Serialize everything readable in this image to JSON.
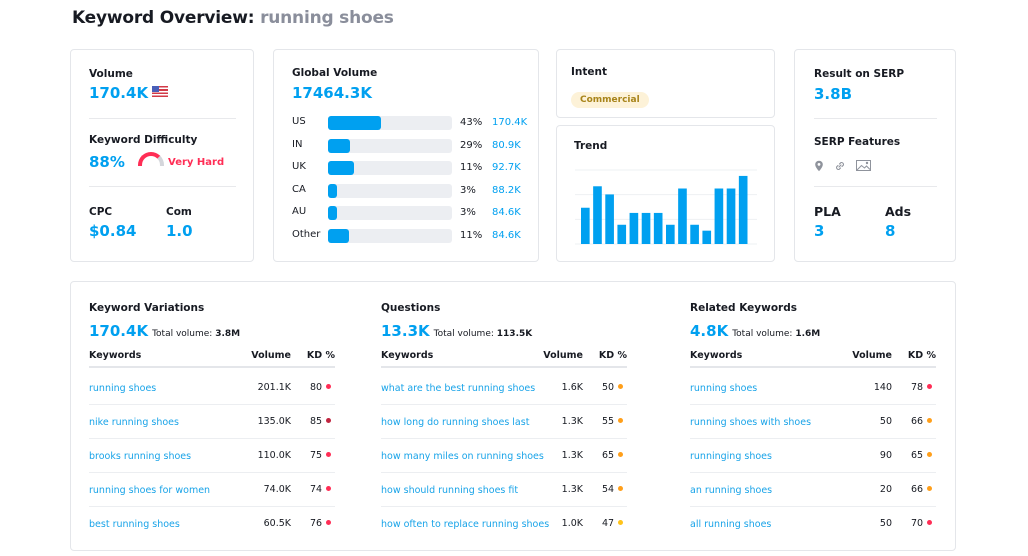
{
  "header": {
    "title_prefix": "Keyword Overview:",
    "keyword": "running shoes"
  },
  "colors": {
    "accent": "#00a0f0",
    "link": "#18a3e8",
    "hard": "#ff2d55",
    "very_hard_dot": "#c0243f",
    "medium": "#ff9f1a",
    "easy": "#ffc31a",
    "intent_bg": "#fdf2d8",
    "intent_text": "#a8841a"
  },
  "volume_card": {
    "volume_label": "Volume",
    "volume_value": "170.4K",
    "flag_icon": "us-flag-icon",
    "kd_label": "Keyword Difficulty",
    "kd_value": "88%",
    "kd_percent": 88,
    "kd_text": "Very Hard",
    "cpc_label": "CPC",
    "cpc_value": "$0.84",
    "com_label": "Com",
    "com_value": "1.0"
  },
  "global_volume": {
    "label": "Global Volume",
    "value": "17464.3K",
    "countries": [
      {
        "code": "US",
        "pct": "43%",
        "share": 43,
        "volume": "170.4K"
      },
      {
        "code": "IN",
        "pct": "29%",
        "share": 18,
        "volume": "80.9K"
      },
      {
        "code": "UK",
        "pct": "11%",
        "share": 21,
        "volume": "92.7K"
      },
      {
        "code": "CA",
        "pct": "3%",
        "share": 7,
        "volume": "88.2K"
      },
      {
        "code": "AU",
        "pct": "3%",
        "share": 7,
        "volume": "84.6K"
      },
      {
        "code": "Other",
        "pct": "11%",
        "share": 17,
        "volume": "84.6K"
      }
    ]
  },
  "intent": {
    "label": "Intent",
    "value": "Commercial"
  },
  "trend": {
    "label": "Trend",
    "values": [
      49,
      78,
      67,
      26,
      42,
      42,
      42,
      26,
      75,
      26,
      18,
      75,
      75,
      92
    ]
  },
  "serp": {
    "result_label": "Result on SERP",
    "result_value": "3.8B",
    "features_label": "SERP Features",
    "features": [
      "location-pin-icon",
      "link-icon",
      "image-icon"
    ],
    "pla_label": "PLA",
    "pla_value": "3",
    "ads_label": "Ads",
    "ads_value": "8"
  },
  "sections": [
    {
      "title": "Keyword Variations",
      "count": "170.4K",
      "total_label": "Total volume:",
      "total_value": "3.8M",
      "headers": {
        "keyword": "Keywords",
        "volume": "Volume",
        "kd": "KD %"
      },
      "rows": [
        {
          "keyword": "running shoes",
          "volume": "201.1K",
          "kd": "80",
          "level": "hard"
        },
        {
          "keyword": "nike running shoes",
          "volume": "135.0K",
          "kd": "85",
          "level": "very_hard"
        },
        {
          "keyword": "brooks running shoes",
          "volume": "110.0K",
          "kd": "75",
          "level": "hard"
        },
        {
          "keyword": "running shoes for women",
          "volume": "74.0K",
          "kd": "74",
          "level": "hard"
        },
        {
          "keyword": "best running shoes",
          "volume": "60.5K",
          "kd": "76",
          "level": "hard"
        }
      ]
    },
    {
      "title": "Questions",
      "count": "13.3K",
      "total_label": "Total volume:",
      "total_value": "113.5K",
      "headers": {
        "keyword": "Keywords",
        "volume": "Volume",
        "kd": "KD %"
      },
      "rows": [
        {
          "keyword": "what are the best running shoes",
          "volume": "1.6K",
          "kd": "50",
          "level": "medium"
        },
        {
          "keyword": "how long do running shoes last",
          "volume": "1.3K",
          "kd": "55",
          "level": "medium"
        },
        {
          "keyword": "how many miles on running shoes",
          "volume": "1.3K",
          "kd": "65",
          "level": "medium"
        },
        {
          "keyword": "how should running shoes fit",
          "volume": "1.3K",
          "kd": "54",
          "level": "medium"
        },
        {
          "keyword": "how often to replace running shoes",
          "volume": "1.0K",
          "kd": "47",
          "level": "easy"
        }
      ]
    },
    {
      "title": "Related Keywords",
      "count": "4.8K",
      "total_label": "Total volume:",
      "total_value": "1.6M",
      "headers": {
        "keyword": "Keywords",
        "volume": "Volume",
        "kd": "KD %"
      },
      "rows": [
        {
          "keyword": "running shoes",
          "volume": "140",
          "kd": "78",
          "level": "hard"
        },
        {
          "keyword": "running shoes with shoes",
          "volume": "50",
          "kd": "66",
          "level": "medium"
        },
        {
          "keyword": "runninging shoes",
          "volume": "90",
          "kd": "65",
          "level": "medium"
        },
        {
          "keyword": "an running shoes",
          "volume": "20",
          "kd": "66",
          "level": "medium"
        },
        {
          "keyword": "all running shoes",
          "volume": "50",
          "kd": "70",
          "level": "hard"
        }
      ]
    }
  ]
}
